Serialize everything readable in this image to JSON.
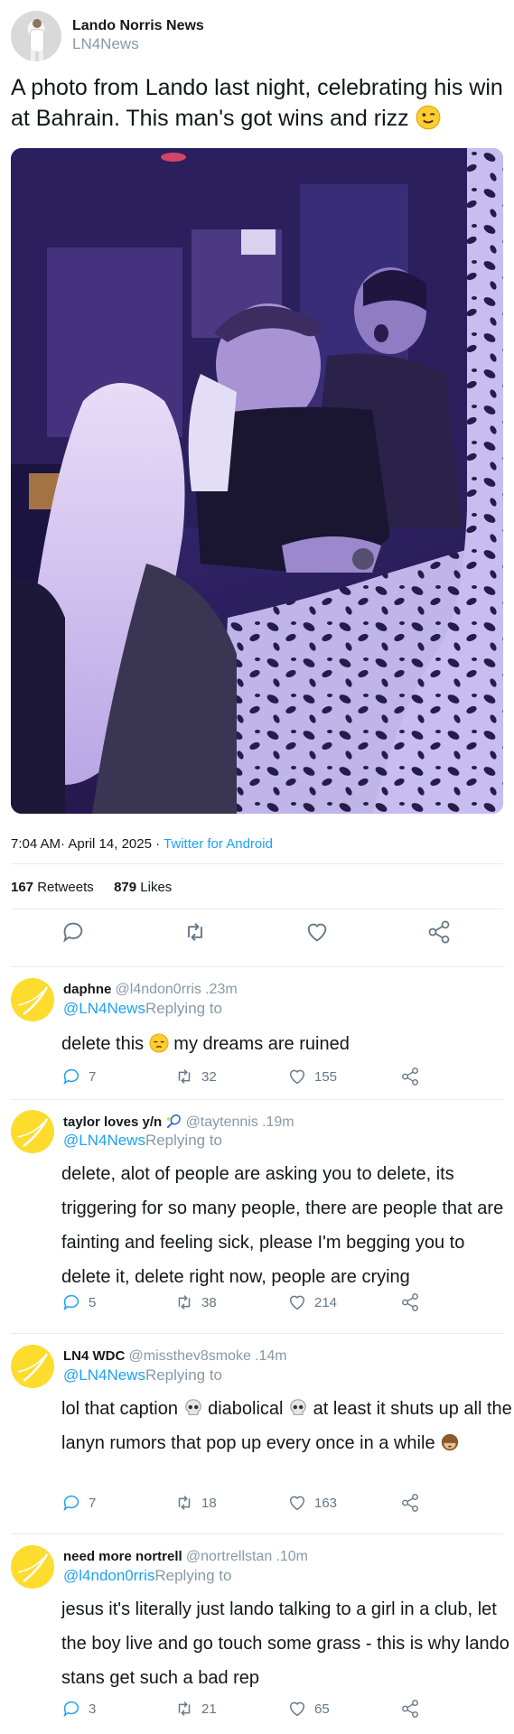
{
  "author": {
    "name": "Lando Norris News",
    "handle": "LN4News"
  },
  "tweet": {
    "text": "A photo from Lando last night, celebrating his win at Bahrain. This man's got wins and rizz",
    "time": "7:04 AM·",
    "date": "April 14, 2025",
    "sep": "·",
    "source": "Twitter for Android",
    "retweets": "167",
    "retweets_label": "Retweets",
    "likes": "879",
    "likes_label": "Likes"
  },
  "icons": {
    "reply": "reply-icon",
    "retweet": "retweet-icon",
    "like": "heart-icon",
    "share": "share-icon"
  },
  "colors": {
    "link": "#1da1f2",
    "muted": "#8899a6",
    "avatar_bg": "#fddc2e"
  },
  "replies": [
    {
      "name": "daphne",
      "handle": "@l4ndon0rris",
      "time": ".23m",
      "to": "@LN4News",
      "replying": "Replying to",
      "body_a": "delete this",
      "body_b": "my dreams are ruined",
      "replies": "7",
      "retweets": "32",
      "likes": "155"
    },
    {
      "name": "taylor loves y/n",
      "handle": "@taytennis",
      "time": ".19m",
      "to": "@LN4News",
      "replying": "Replying to",
      "body": "delete, alot of people are asking you to delete, its triggering for so many people, there are people that are fainting and feeling sick, please I'm begging you to delete it, delete right now, people are crying",
      "replies": "5",
      "retweets": "38",
      "likes": "214"
    },
    {
      "name": "LN4 WDC",
      "handle": "@missthev8smoke",
      "time": ".14m",
      "to": "@LN4News",
      "replying": "Replying to",
      "body_a": "lol that caption",
      "body_b": "diabolical",
      "body_c": "at least it shuts up all the lanyn rumors that pop up every once in a while",
      "replies": "7",
      "retweets": "18",
      "likes": "163"
    },
    {
      "name": "need more nortrell",
      "handle": "@nortrellstan",
      "time": ".10m",
      "to": "@l4ndon0rris",
      "replying": "Replying to",
      "body": "jesus it's literally just lando talking to a girl in a club, let the boy live and go touch some grass - this is why lando stans get such a bad rep",
      "replies": "3",
      "retweets": "21",
      "likes": "65"
    }
  ]
}
